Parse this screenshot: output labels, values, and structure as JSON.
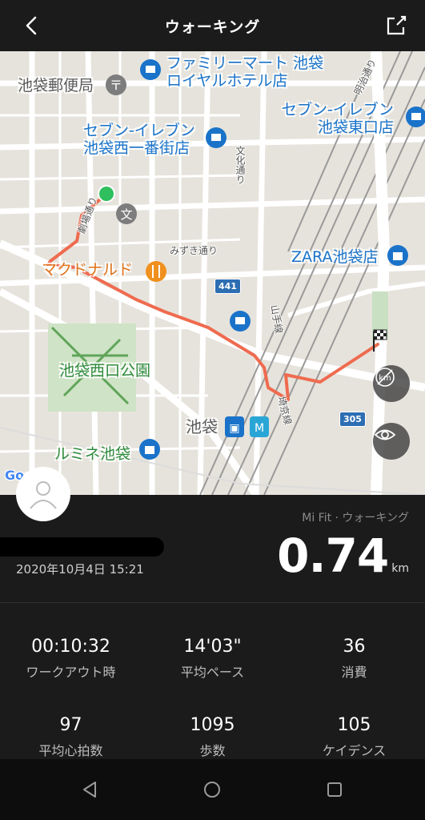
{
  "header": {
    "title": "ウォーキング",
    "back_icon": "back-arrow-icon",
    "share_icon": "share-icon"
  },
  "map": {
    "pois": {
      "familymart": "ファミリーマート 池袋\nロイヤルホテル店",
      "post_office": "池袋郵便局",
      "seven_nishi": "セブン-イレブン\n池袋西一番街店",
      "seven_higashi": "セブン-イレブン\n池袋東口店",
      "mcdonalds": "マクドナルド",
      "zara": "ZARA池袋店",
      "park": "池袋西口公園",
      "station": "池袋",
      "lumine": "ルミネ池袋"
    },
    "streets": {
      "bunka": "文化通り",
      "gekijo": "劇場通り",
      "mizuki": "みずき通り",
      "meiji": "明治通り",
      "yamanote": "山手線",
      "saikyo": "埼京線"
    },
    "route_441": "441",
    "route_305": "305",
    "google": "Google"
  },
  "workout": {
    "source": "Mi Fit · ウォーキング",
    "date": "2020年10月4日 15:21",
    "distance": "0.74",
    "distance_unit": "km"
  },
  "stats": [
    {
      "value": "00:10:32",
      "label": "ワークアウト時"
    },
    {
      "value": "14'03\"",
      "label": "平均ペース"
    },
    {
      "value": "36",
      "label": "消費"
    },
    {
      "value": "97",
      "label": "平均心拍数"
    },
    {
      "value": "1095",
      "label": "歩数"
    },
    {
      "value": "105",
      "label": "ケイデンス"
    }
  ],
  "colors": {
    "route": "#ef6b4f",
    "start": "#2fbf5e",
    "poi_blue": "#1a73c9",
    "park_green": "#2e8b3c"
  }
}
